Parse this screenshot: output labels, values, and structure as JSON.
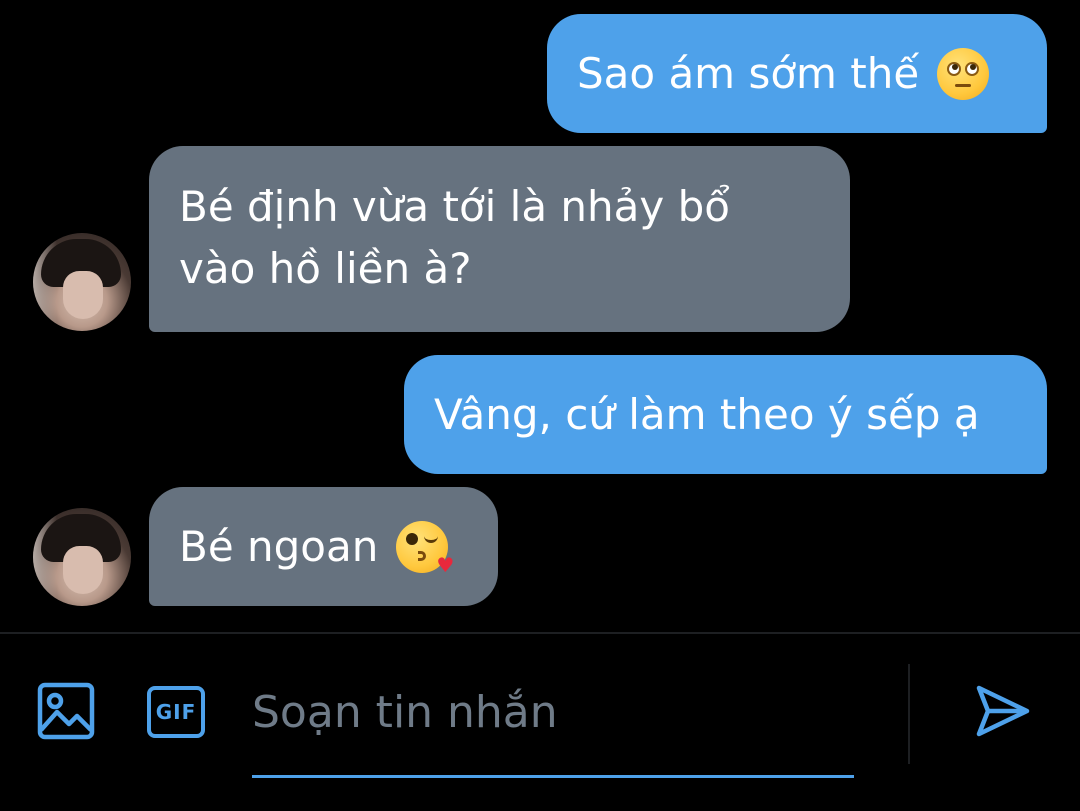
{
  "messages": [
    {
      "direction": "sent",
      "text": "Sao ám sớm thế",
      "emoji": "face-with-rolling-eyes-emoji"
    },
    {
      "direction": "received",
      "text": "Bé định vừa tới là nhảy bổ vào hồ liền à?"
    },
    {
      "direction": "sent",
      "text": "Vâng, cứ làm theo ý sếp ạ"
    },
    {
      "direction": "received",
      "text": "Bé ngoan",
      "emoji": "face-blowing-a-kiss-emoji"
    }
  ],
  "composer": {
    "placeholder": "Soạn tin nhắn",
    "image_icon": "image-icon",
    "gif_label": "GIF",
    "send_icon": "send-icon"
  },
  "colors": {
    "background": "#000000",
    "sent_bubble": "#4ea1ea",
    "received_bubble": "#66727f",
    "accent": "#4ea1ea",
    "placeholder": "#6f7b88"
  }
}
